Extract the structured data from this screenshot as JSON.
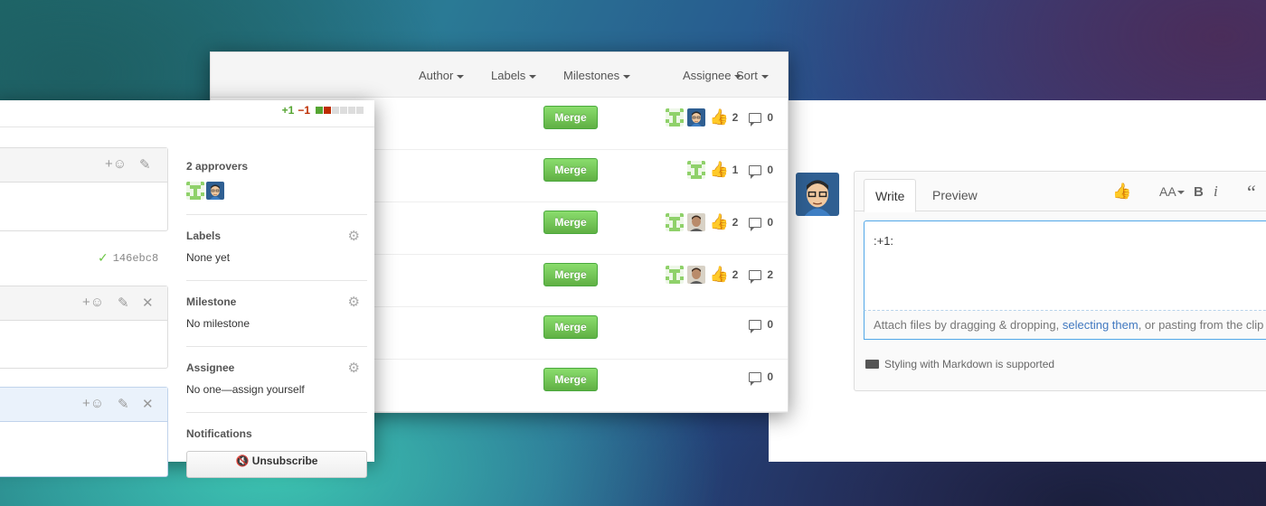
{
  "comment_box": {
    "tabs": {
      "write": "Write",
      "preview": "Preview"
    },
    "toolbar": {
      "emoji": "thumbsup-icon",
      "heading": "AA",
      "bold": "B",
      "italic": "i",
      "quote": "“"
    },
    "textarea_value": ":+1:",
    "attach": {
      "prefix": "Attach files by dragging & dropping, ",
      "link": "selecting them",
      "suffix": ", or pasting from the clip"
    },
    "markdown_note": "Styling with Markdown is supported"
  },
  "pr_list": {
    "filters": [
      "Author",
      "Labels",
      "Milestones",
      "Assignee",
      "Sort"
    ],
    "merge_label": "Merge",
    "rows": [
      {
        "thumbs": "2",
        "comments": "0",
        "avatars": [
          "identicon",
          "cartoon"
        ]
      },
      {
        "thumbs": "1",
        "comments": "0",
        "avatars": [
          "identicon"
        ]
      },
      {
        "thumbs": "2",
        "comments": "0",
        "avatars": [
          "identicon",
          "photo"
        ]
      },
      {
        "thumbs": "2",
        "comments": "2",
        "avatars": [
          "identicon",
          "photo"
        ]
      },
      {
        "thumbs": "",
        "comments": "0",
        "avatars": []
      },
      {
        "thumbs": "",
        "comments": "0",
        "avatars": []
      }
    ]
  },
  "issue_sidebar": {
    "votes": {
      "up": "+1",
      "down": "−1",
      "approved_fraction": 0.33
    },
    "commit_sha": "146ebc8",
    "approvers_title": "2 approvers",
    "labels": {
      "title": "Labels",
      "value": "None yet"
    },
    "milestone": {
      "title": "Milestone",
      "value": "No milestone"
    },
    "assignee": {
      "title": "Assignee",
      "value": "No one—assign yourself"
    },
    "notifications": {
      "title": "Notifications",
      "button": "Unsubscribe"
    }
  },
  "colors": {
    "merge_green": "#6cc644",
    "link_blue": "#4078c0",
    "vote_up": "#55a532",
    "vote_down": "#bd2c00"
  }
}
